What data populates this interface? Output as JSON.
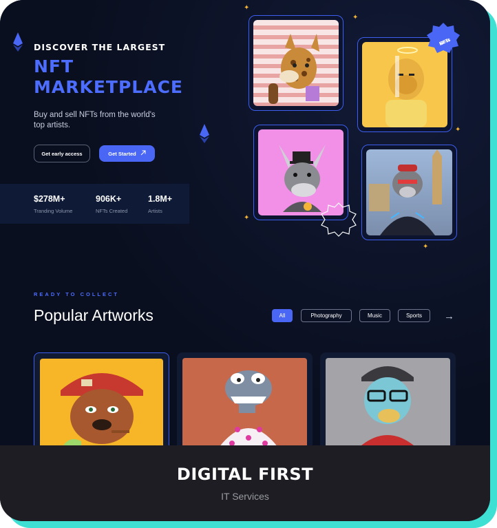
{
  "hero": {
    "eyebrow": "DISCOVER THE LARGEST",
    "title_line1": "NFT",
    "title_line2": "MARKETPLACE",
    "subtitle": "Buy and sell NFTs from the world's top artists.",
    "early_access_label": "Get early access",
    "get_started_label": "Get Started",
    "arrow_icon": "arrow-up-right-icon"
  },
  "stats": [
    {
      "value": "$278M+",
      "label": "Tranding Volume"
    },
    {
      "value": "906K+",
      "label": "NFTs Created"
    },
    {
      "value": "1.8M+",
      "label": "Artists"
    }
  ],
  "badge": {
    "line1": "Best",
    "line2": "NFTs"
  },
  "gallery": {
    "featured": [
      {
        "name": "giraffe-dog-nft",
        "bg": "#f3d6d6"
      },
      {
        "name": "golden-ape-nft",
        "bg": "#f7c64a"
      },
      {
        "name": "bull-nft",
        "bg": "#f290e8"
      },
      {
        "name": "london-ape-nft",
        "bg": "#8fa6c8"
      }
    ]
  },
  "popular": {
    "eyebrow": "READY TO COLLECT",
    "title": "Popular Artworks",
    "filters": [
      "All",
      "Photography",
      "Music",
      "Sports"
    ],
    "active_filter": "All",
    "cards": [
      {
        "name": "bulldog-nft",
        "bg": "#f7b528"
      },
      {
        "name": "dino-nft",
        "bg": "#c8684a"
      },
      {
        "name": "bored-ape-nft",
        "bg": "#a3a3a8"
      }
    ]
  },
  "footer": {
    "brand": "DIGITAL FIRST",
    "tagline": "IT Services"
  },
  "colors": {
    "accent": "#4a66f5",
    "background": "#0b1120",
    "border_glow": "#3ee0d3",
    "sparkle": "#f3b437"
  }
}
